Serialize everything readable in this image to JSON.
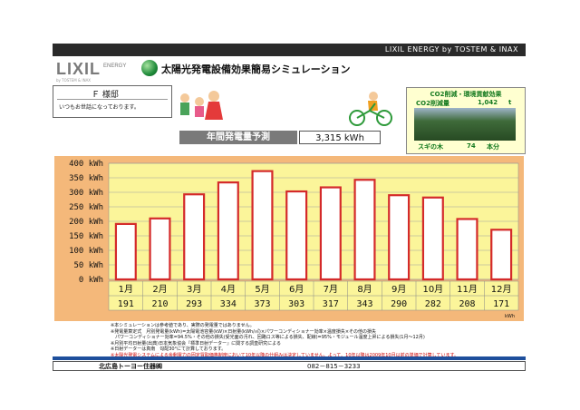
{
  "header": {
    "brand_bar": "LIXIL  ENERGY  by  TOSTEM & INAX",
    "logo_main": "LIXIL",
    "logo_energy": "ENERGY",
    "logo_tagline": "by TOSTEM & INAX",
    "title": "太陽光発電設備効果簡易シミュレーション"
  },
  "customer": {
    "name": "Ｆ 様邸",
    "message": "いつもお世話になっております。"
  },
  "annual": {
    "label": "年間発電量予測",
    "value": "3,315 kWh"
  },
  "co2": {
    "title": "CO2削減・環境貢献効果",
    "reduction_label": "CO2削減量",
    "reduction_value": "1,042",
    "reduction_unit": "t",
    "trees_label": "スギの木",
    "trees_value": "74",
    "trees_unit": "本分"
  },
  "chart_data": {
    "type": "bar",
    "categories": [
      "1月",
      "2月",
      "3月",
      "4月",
      "5月",
      "6月",
      "7月",
      "8月",
      "9月",
      "10月",
      "11月",
      "12月"
    ],
    "values": [
      191,
      210,
      293,
      334,
      373,
      303,
      317,
      343,
      290,
      282,
      208,
      171
    ],
    "y_ticks": [
      "400 kWh",
      "350 kWh",
      "300 kWh",
      "250 kWh",
      "200 kWh",
      "150 kWh",
      "100 kWh",
      "50 kWh",
      "0 kWh"
    ],
    "ylim": [
      0,
      400
    ],
    "unit_note": "kWh",
    "colors": {
      "frame": "#f4b87a",
      "plot": "#fbf59a",
      "bar_edge": "#d42a2a",
      "bar_fill": "#ffffff",
      "label_bg": "#fbf59a"
    }
  },
  "notes": [
    "※本シミュレーションは参考値であり、実際の発電量ではありません。",
    "※発電量算定式　月別発電量(kWh)=太陽電池容量(kW)×日射量(kWh/㎡)×パワーコンディショナー効率×温度損失×その他の損失",
    "　パワーコンディショナー効率=94.5%・その他の損失(受光面の汚れ、回路ロス等による損失、配線)=95%・モジュール温度上昇による損失(1月〜12月)",
    "※月別平均日射量(出典)日本気象協会『標準日射データー』に関する調査研究による",
    "※日射データーは真南　勾配30°にて計算しております。",
    "※太陽光発電システムによる余剰電力の固定買取価格制度において10年以降の仕組みは決定していません。よって、10年以降は2009年10月以前の単価で計算しています。"
  ],
  "footer": {
    "company": "北広島トーヨー住器㈱",
    "phone": "082－815－3233"
  }
}
